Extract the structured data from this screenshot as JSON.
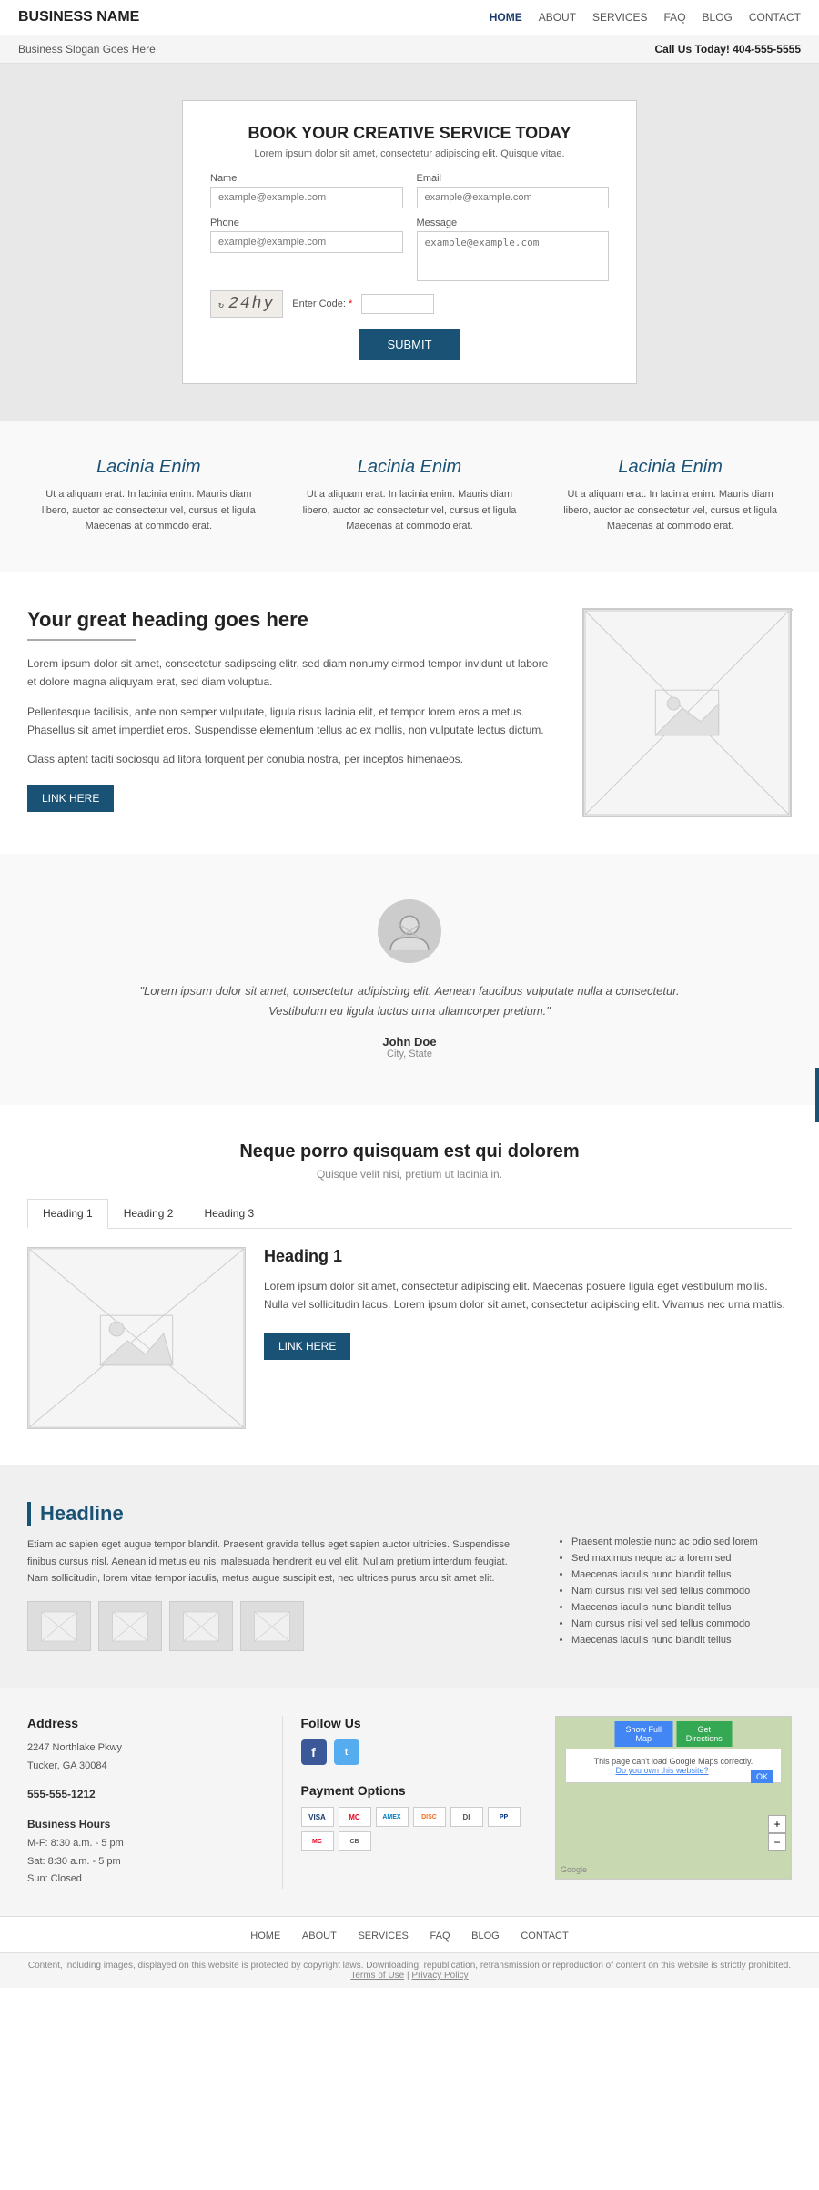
{
  "nav": {
    "logo": "BUSINESS NAME",
    "links": [
      {
        "label": "HOME",
        "active": true
      },
      {
        "label": "ABOUT",
        "active": false
      },
      {
        "label": "SERVICES",
        "active": false
      },
      {
        "label": "FAQ",
        "active": false
      },
      {
        "label": "BLOG",
        "active": false
      },
      {
        "label": "CONTACT",
        "active": false
      }
    ]
  },
  "topbar": {
    "slogan": "Business Slogan Goes Here",
    "phone": "Call Us Today! 404-555-5555"
  },
  "hero": {
    "title": "BOOK YOUR CREATIVE SERVICE TODAY",
    "subtitle": "Lorem ipsum dolor sit amet, consectetur adipiscing elit. Quisque vitae.",
    "fields": {
      "name_label": "Name",
      "name_placeholder": "example@example.com",
      "email_label": "Email",
      "email_placeholder": "example@example.com",
      "phone_label": "Phone",
      "phone_placeholder": "example@example.com",
      "message_label": "Message",
      "message_placeholder": "example@example.com"
    },
    "captcha": {
      "text": "24hy",
      "label": "Enter Code:",
      "required": "*"
    },
    "submit": "SUBMIT"
  },
  "features": [
    {
      "title": "Lacinia Enim",
      "text": "Ut a aliquam erat. In lacinia enim. Mauris diam libero, auctor ac consectetur vel, cursus et ligula Maecenas at commodo erat."
    },
    {
      "title": "Lacinia Enim",
      "text": "Ut a aliquam erat. In lacinia enim. Mauris diam libero, auctor ac consectetur vel, cursus et ligula Maecenas at commodo erat."
    },
    {
      "title": "Lacinia Enim",
      "text": "Ut a aliquam erat. In lacinia enim. Mauris diam libero, auctor ac consectetur vel, cursus et ligula Maecenas at commodo erat."
    }
  ],
  "content": {
    "heading": "Your great heading goes here",
    "paragraphs": [
      "Lorem ipsum dolor sit amet, consectetur sadipscing elitr, sed diam nonumy eirmod tempor invidunt ut labore et dolore magna aliquyam erat, sed diam voluptua.",
      "Pellentesque facilisis, ante non semper vulputate, ligula risus lacinia elit, et tempor lorem eros a metus. Phasellus sit amet imperdiet eros. Suspendisse elementum tellus ac ex mollis, non vulputate lectus dictum.",
      "Class aptent taciti sociosqu ad litora torquent per conubia nostra, per inceptos himenaeos."
    ],
    "link_label": "LINK HERE"
  },
  "testimonial": {
    "quote": "\"Lorem ipsum dolor sit amet, consectetur adipiscing elit. Aenean faucibus vulputate nulla a consectetur. Vestibulum eu ligula luctus urna ullamcorper pretium.\"",
    "name": "John Doe",
    "location": "City, State"
  },
  "tabs_section": {
    "title": "Neque porro quisquam est qui dolorem",
    "subtitle": "Quisque velit nisi, pretium ut lacinia in.",
    "tabs": [
      {
        "label": "Heading 1",
        "active": true
      },
      {
        "label": "Heading 2",
        "active": false
      },
      {
        "label": "Heading 3",
        "active": false
      }
    ],
    "active_content": {
      "heading": "Heading 1",
      "text": "Lorem ipsum dolor sit amet, consectetur adipiscing elit. Maecenas posuere ligula eget vestibulum mollis. Nulla vel sollicitudin lacus. Lorem ipsum dolor sit amet, consectetur adipiscing elit. Vivamus nec urna mattis.",
      "link_label": "LINK HERE"
    }
  },
  "headline_section": {
    "heading": "Headline",
    "text": "Etiam ac sapien eget augue tempor blandit. Praesent gravida tellus eget sapien auctor ultricies. Suspendisse finibus cursus nisl. Aenean id metus eu nisl malesuada hendrerit eu vel elit. Nullam pretium interdum feugiat. Nam sollicitudin, lorem vitae tempor iaculis, metus augue suscipit est, nec ultrices purus arcu sit amet elit.",
    "list": [
      "Praesent molestie nunc ac odio sed lorem",
      "Sed maximus neque ac a lorem sed",
      "Maecenas iaculis nunc blandit tellus",
      "Nam cursus nisi vel sed tellus commodo",
      "Maecenas iaculis nunc blandit tellus",
      "Nam cursus nisi vel sed tellus commodo",
      "Maecenas iaculis nunc blandit tellus"
    ]
  },
  "footer": {
    "address": {
      "heading": "Address",
      "street": "2247 Northlake Pkwy",
      "city": "Tucker, GA 30084",
      "phone": "555-555-1212",
      "hours_heading": "Business Hours",
      "hours": [
        "M-F: 8:30 a.m. - 5 pm",
        "Sat: 8:30 a.m. - 5 pm",
        "Sun: Closed"
      ]
    },
    "follow": {
      "heading": "Follow Us",
      "payment_heading": "Payment Options",
      "payment_icons": [
        "VISA",
        "MC",
        "AMEX",
        "DISC",
        "DI",
        "PP",
        "MC2",
        "CB"
      ]
    },
    "map": {
      "btn_map": "Show Full Map",
      "btn_directions": "Get Directions",
      "error": "This page can't load Google Maps correctly.",
      "error_link": "Do you own this website?",
      "ok": "OK"
    },
    "nav_links": [
      "HOME",
      "ABOUT",
      "SERVICES",
      "FAQ",
      "BLOG",
      "CONTACT"
    ],
    "bottom": "Content, including images, displayed on this website is protected by copyright laws. Downloading, republication, retransmission or reproduction of content on this website is strictly prohibited.",
    "terms": "Terms of Use",
    "privacy": "Privacy Policy"
  }
}
